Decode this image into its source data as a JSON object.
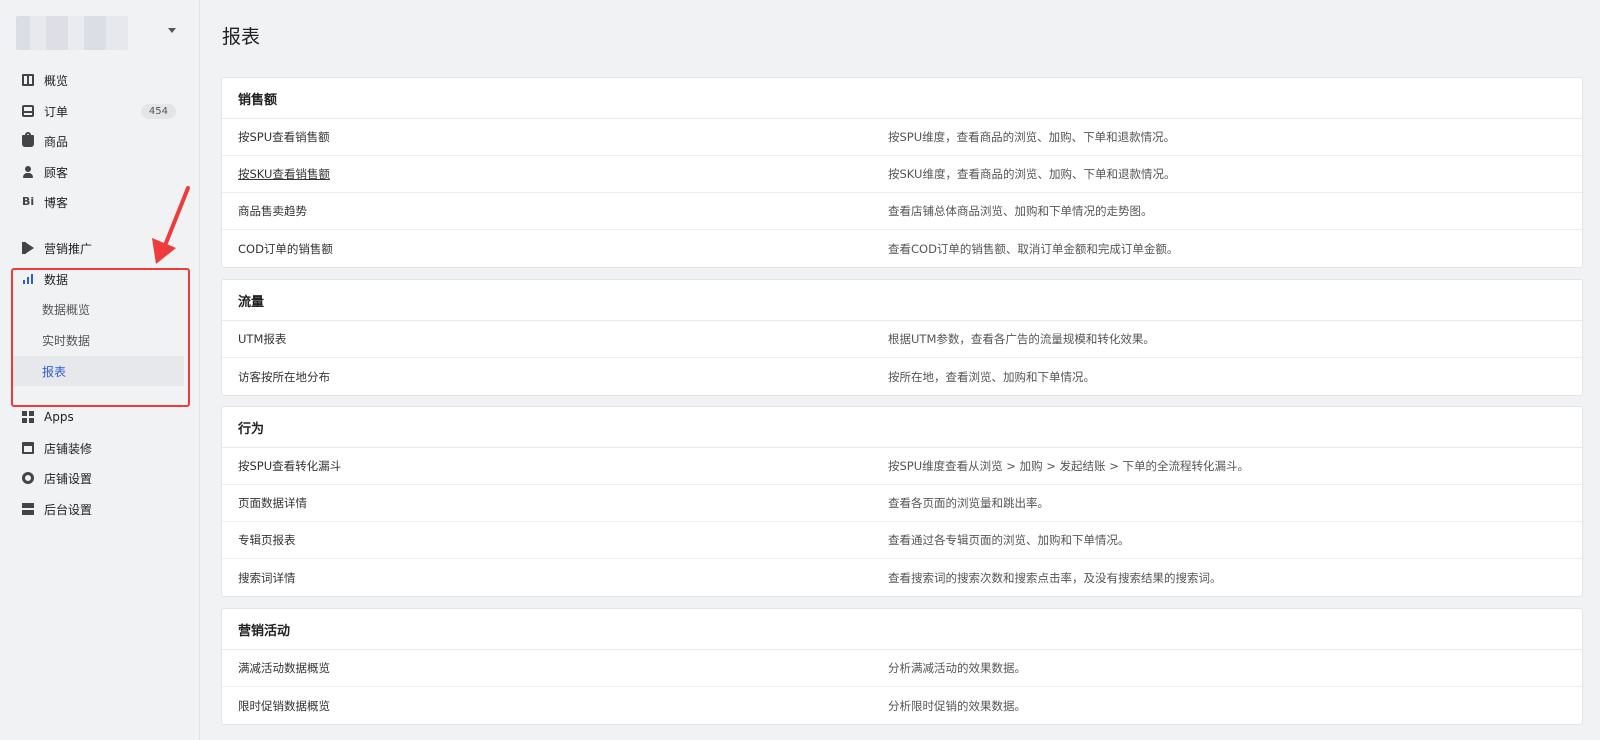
{
  "page": {
    "title": "报表"
  },
  "sidebar": {
    "order_badge": "454",
    "items": [
      {
        "label": "概览"
      },
      {
        "label": "订单"
      },
      {
        "label": "商品"
      },
      {
        "label": "顾客"
      },
      {
        "label": "博客"
      },
      {
        "label": "营销推广"
      },
      {
        "label": "数据"
      },
      {
        "label": "Apps"
      },
      {
        "label": "店铺装修"
      },
      {
        "label": "店铺设置"
      },
      {
        "label": "后台设置"
      }
    ],
    "data_sub": [
      {
        "label": "数据概览"
      },
      {
        "label": "实时数据"
      },
      {
        "label": "报表"
      }
    ],
    "blog_icon": "Bi",
    "accent": "#2e5bd8",
    "highlight_color": "#ef3b3b"
  },
  "sections": [
    {
      "title": "销售额",
      "rows": [
        {
          "name": "按SPU查看销售额",
          "desc": "按SPU维度，查看商品的浏览、加购、下单和退款情况。"
        },
        {
          "name": "按SKU查看销售额",
          "desc": "按SKU维度，查看商品的浏览、加购、下单和退款情况。"
        },
        {
          "name": "商品售卖趋势",
          "desc": "查看店铺总体商品浏览、加购和下单情况的走势图。"
        },
        {
          "name": "COD订单的销售额",
          "desc": "查看COD订单的销售额、取消订单金额和完成订单金额。"
        }
      ]
    },
    {
      "title": "流量",
      "rows": [
        {
          "name": "UTM报表",
          "desc": "根据UTM参数，查看各广告的流量规模和转化效果。"
        },
        {
          "name": "访客按所在地分布",
          "desc": "按所在地，查看浏览、加购和下单情况。"
        }
      ]
    },
    {
      "title": "行为",
      "rows": [
        {
          "name": "按SPU查看转化漏斗",
          "desc": "按SPU维度查看从浏览 > 加购 > 发起结账 > 下单的全流程转化漏斗。"
        },
        {
          "name": "页面数据详情",
          "desc": "查看各页面的浏览量和跳出率。"
        },
        {
          "name": "专辑页报表",
          "desc": "查看通过各专辑页面的浏览、加购和下单情况。"
        },
        {
          "name": "搜索词详情",
          "desc": "查看搜索词的搜索次数和搜索点击率，及没有搜索结果的搜索词。"
        }
      ]
    },
    {
      "title": "营销活动",
      "rows": [
        {
          "name": "满减活动数据概览",
          "desc": "分析满减活动的效果数据。"
        },
        {
          "name": "限时促销数据概览",
          "desc": "分析限时促销的效果数据。"
        }
      ]
    }
  ]
}
